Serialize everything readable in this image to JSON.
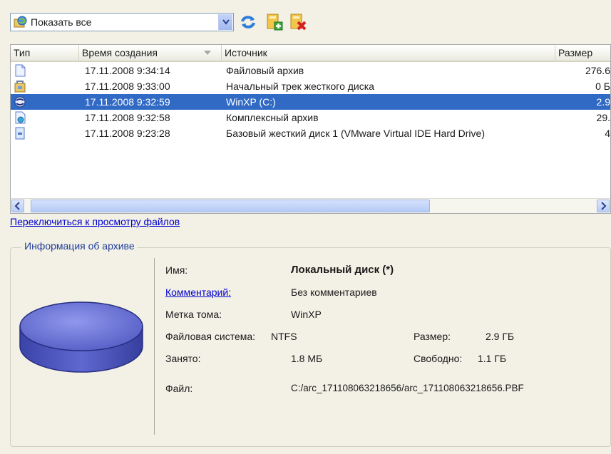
{
  "toolbar": {
    "filter_value": "Показать все",
    "filter_icon": "globe-filter-icon",
    "refresh_icon": "refresh-icon",
    "add_icon": "add-archive-icon",
    "delete_icon": "delete-archive-icon"
  },
  "list": {
    "columns": [
      "Тип",
      "Время создания",
      "Источник",
      "Размер"
    ],
    "sorted_column": "Время создания",
    "rows": [
      {
        "icon": "file-archive-icon",
        "time": "17.11.2008 9:34:14",
        "source": "Файловый архив",
        "size": "276.6"
      },
      {
        "icon": "track-archive-icon",
        "time": "17.11.2008 9:33:00",
        "source": "Начальный трек жесткого диска",
        "size": "0 Б"
      },
      {
        "icon": "partition-archive-icon",
        "time": "17.11.2008 9:32:59",
        "source": "WinXP (C:)",
        "size": "2.9",
        "selected": true
      },
      {
        "icon": "complex-archive-icon",
        "time": "17.11.2008 9:32:58",
        "source": "Комплексный архив",
        "size": "29."
      },
      {
        "icon": "disk-archive-icon",
        "time": "17.11.2008 9:23:28",
        "source": "Базовый жесткий диск 1 (VMware Virtual IDE Hard Drive)",
        "size": "4"
      }
    ]
  },
  "switch_link": "Переключиться к просмотру файлов",
  "info": {
    "legend": "Информация об архиве",
    "name_label": "Имя:",
    "name_value": "Локальный диск (*)",
    "comment_label": "Комментарий:",
    "comment_value": "Без комментариев",
    "volume_label": "Метка тома:",
    "volume_value": "WinXP",
    "fs_label": "Файловая система:",
    "fs_value": "NTFS",
    "size_label": "Размер:",
    "size_value": "2.9 ГБ",
    "used_label": "Занято:",
    "used_value": "1.8 МБ",
    "free_label": "Свободно:",
    "free_value": "1.1 ГБ",
    "file_label": "Файл:",
    "file_value": "C:/arc_171108063218656/arc_171108063218656.PBF",
    "disk_icon": "disk-image-icon"
  },
  "colors": {
    "selection": "#316ac5",
    "disk": "#5b64c8",
    "link": "#0000cc"
  }
}
